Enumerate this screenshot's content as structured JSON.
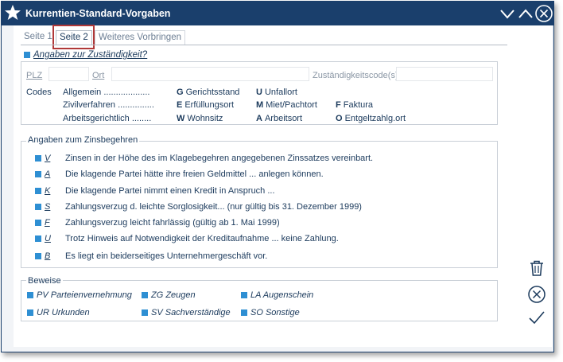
{
  "window": {
    "title": "Kurrentien-Standard-Vorgaben"
  },
  "tabs": [
    {
      "label": "Seite 1",
      "active": false
    },
    {
      "label": "Seite 2",
      "active": true
    },
    {
      "label": "Weiteres Vorbringen",
      "active": false
    }
  ],
  "zustaendigkeit": {
    "heading": "Angaben zur Zuständigkeit?",
    "plz_label": "PLZ",
    "plz_value": "",
    "ort_label": "Ort",
    "ort_value": "",
    "code_label": "Zuständigkeitscode(s)",
    "code_value": "",
    "codes_label": "Codes",
    "codes": [
      {
        "text": "Allgemein ..................."
      },
      {
        "text": "Zivilverfahren ..............."
      },
      {
        "text": "Arbeitsgerichtlich ........"
      },
      {
        "key": "G",
        "text": "Gerichtsstand"
      },
      {
        "key": "E",
        "text": "Erfüllungsort"
      },
      {
        "key": "W",
        "text": "Wohnsitz"
      },
      {
        "key": "U",
        "text": "Unfallort"
      },
      {
        "key": "M",
        "text": "Miet/Pachtort"
      },
      {
        "key": "A",
        "text": "Arbeitsort"
      },
      {
        "key": "F",
        "text": "Faktura"
      },
      {
        "key": "O",
        "text": "Entgeltzahlg.ort"
      }
    ]
  },
  "zinsbegehren": {
    "heading": "Angaben zum Zinsbegehren",
    "items": [
      {
        "letter": "V",
        "text": "Zinsen in der Höhe des im Klagebegehren angegebenen Zinssatzes vereinbart."
      },
      {
        "letter": "A",
        "text": "Die klagende Partei hätte ihre freien Geldmittel ... anlegen können."
      },
      {
        "letter": "K",
        "text": "Die klagende Partei nimmt einen Kredit in Anspruch ..."
      },
      {
        "letter": "S",
        "text": "Zahlungsverzug d. leichte Sorglosigkeit... (nur gültig bis 31. Dezember 1999)"
      },
      {
        "letter": "F",
        "text": "Zahlungsverzug leicht fahrlässig (gültig ab 1. Mai 1999)"
      },
      {
        "letter": "U",
        "text": "Trotz Hinweis auf Notwendigkeit der Kreditaufnahme ... keine Zahlung."
      },
      {
        "letter": "B",
        "text": "Es liegt ein beiderseitiges Unternehmergeschäft vor."
      }
    ]
  },
  "beweise": {
    "heading": "Beweise",
    "items": [
      {
        "text": "PV Parteienvernehmung"
      },
      {
        "text": "ZG Zeugen"
      },
      {
        "text": "LA Augenschein"
      },
      {
        "text": "UR Urkunden"
      },
      {
        "text": "SV Sachverständige"
      },
      {
        "text": "SO Sonstige"
      }
    ]
  },
  "icons": {
    "title": "star-icon",
    "minimize": "chevron-down-icon",
    "maximize": "chevron-up-icon",
    "close": "close-circle-icon",
    "delete": "trash-icon",
    "cancel": "cancel-circle-icon",
    "confirm": "checkmark-icon"
  },
  "colors": {
    "titlebar": "#1a3f6c",
    "accent_square": "#2e8fd3",
    "text": "#1b3a5c",
    "tab_highlight": "#b03838"
  }
}
